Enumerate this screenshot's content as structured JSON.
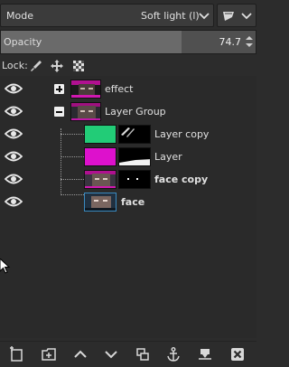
{
  "mode": {
    "label": "Mode",
    "value": "Soft light (l)"
  },
  "opacity": {
    "label": "Opacity",
    "value": "74.7",
    "fraction": 0.71
  },
  "lock": {
    "label": "Lock:",
    "icons": [
      "paintbrush-icon",
      "move-icon",
      "checkerboard-alpha-icon"
    ]
  },
  "layers": [
    {
      "name": "effect",
      "expander": "plus",
      "bold": false
    },
    {
      "name": "Layer Group",
      "expander": "minus",
      "bold": false
    },
    {
      "name": "Layer copy",
      "bold": false,
      "fill": "#22cc77"
    },
    {
      "name": "Layer",
      "bold": false,
      "fill": "#dd11cc"
    },
    {
      "name": "face copy",
      "bold": true
    },
    {
      "name": "face",
      "bold": true
    }
  ],
  "bottom_buttons": [
    "new-layer-icon",
    "new-layer-group-icon",
    "raise-layer-icon",
    "lower-layer-icon",
    "duplicate-layer-icon",
    "anchor-layer-icon",
    "merge-down-icon",
    "delete-layer-icon"
  ],
  "colors": {
    "panel": "#2c2c2c",
    "list": "#2a2a2a",
    "slider": "#505050",
    "slider_fill": "#6a6a6a"
  }
}
